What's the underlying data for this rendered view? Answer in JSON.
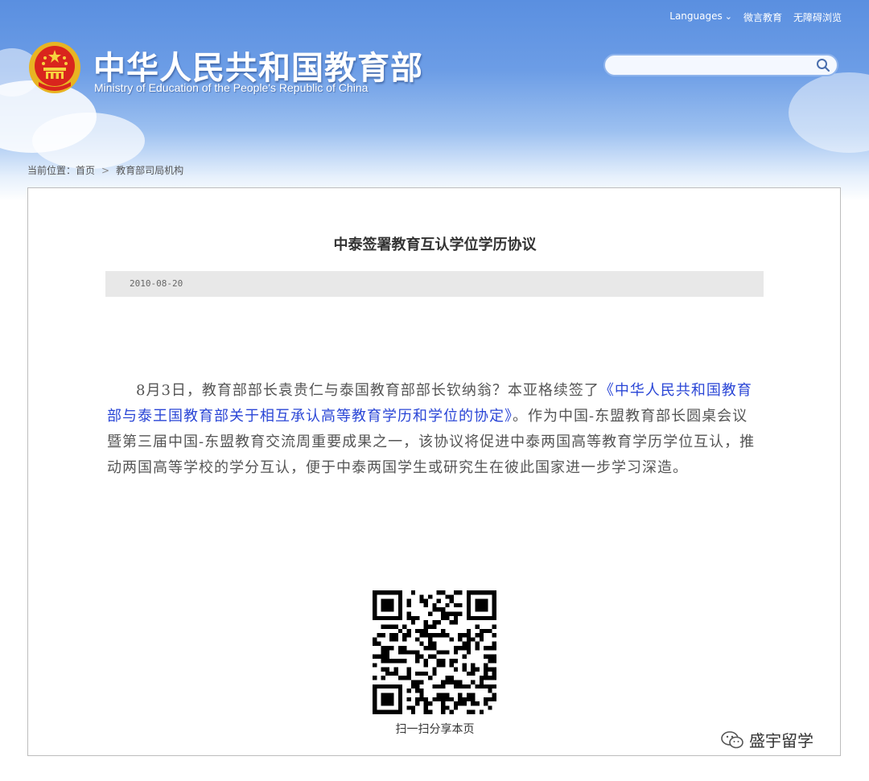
{
  "header": {
    "site_title": "中华人民共和国教育部",
    "site_subtitle": "Ministry of Education of the People's Republic of China",
    "nav": {
      "languages": "Languages",
      "weibo": "微言教育",
      "accessibility": "无障碍浏览"
    },
    "search": {
      "value": "",
      "icon": "search-icon"
    }
  },
  "breadcrumb": {
    "label": "当前位置：",
    "home": "首页",
    "separator": ">",
    "current": "教育部司局机构"
  },
  "article": {
    "title": "中泰签署教育互认学位学历协议",
    "date": "2010-08-20",
    "body_part1": "8月3日，教育部部长袁贵仁与泰国教育部部长钦纳翁？本亚格续签了",
    "body_link": "《中华人民共和国教育部与泰王国教育部关于相互承认高等教育学历和学位的协定》",
    "body_part2": "。作为中国-东盟教育部长圆桌会议暨第三届中国-东盟教育交流周重要成果之一，该协议将促进中泰两国高等教育学历学位互认，推动两国高等学校的学分互认，便于中泰两国学生或研究生在彼此国家进一步学习深造。"
  },
  "share": {
    "qr_caption": "扫一扫分享本页"
  },
  "watermark": {
    "text": "盛宇留学"
  },
  "colors": {
    "header_blue": "#5a8fe0",
    "link_blue": "#2a46d6",
    "date_bar": "#e8e8e8",
    "body_text": "#555555"
  }
}
